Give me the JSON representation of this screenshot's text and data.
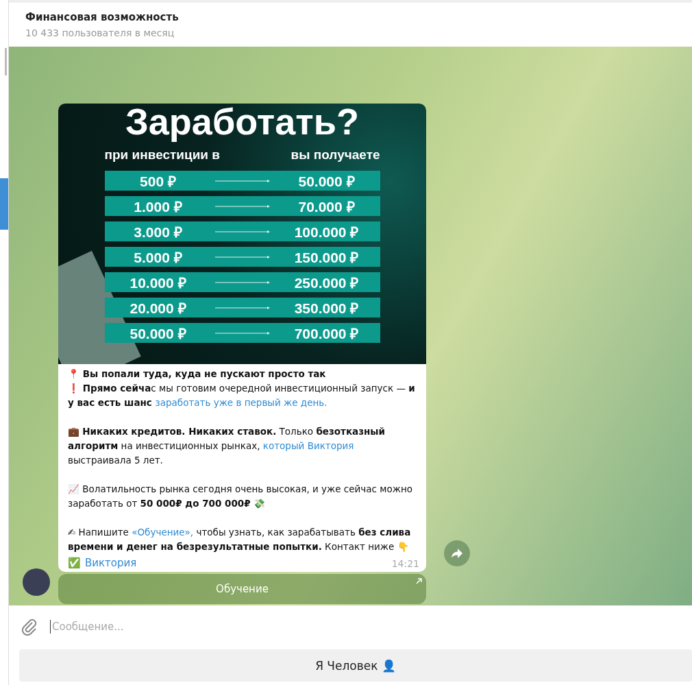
{
  "header": {
    "title": "Финансовая возможность",
    "subtitle": "10 433 пользователя в месяц"
  },
  "promo": {
    "title": "Заработать?",
    "col_left": "при инвестиции в",
    "col_right": "вы получаете",
    "rows": [
      {
        "invest": "500 ₽",
        "get": "50.000 ₽"
      },
      {
        "invest": "1.000 ₽",
        "get": "70.000 ₽"
      },
      {
        "invest": "3.000 ₽",
        "get": "100.000 ₽"
      },
      {
        "invest": "5.000 ₽",
        "get": "150.000 ₽"
      },
      {
        "invest": "10.000 ₽",
        "get": "250.000 ₽"
      },
      {
        "invest": "20.000 ₽",
        "get": "350.000 ₽"
      },
      {
        "invest": "50.000 ₽",
        "get": "700.000 ₽"
      }
    ]
  },
  "message": {
    "blocks": [
      [
        [
          {
            "kind": "bold",
            "text": "📍 Вы попали туда, куда не пускают просто так"
          }
        ],
        [
          {
            "kind": "bold",
            "text": "❗ Прямо сейча"
          },
          {
            "kind": "plain",
            "text": "с мы готовим очередной инвестиционный запуск — "
          },
          {
            "kind": "bold",
            "text": "и у вас есть шанс "
          },
          {
            "kind": "link",
            "text": "заработать уже в первый же день."
          }
        ]
      ],
      [
        [
          {
            "kind": "plain",
            "text": "💼 "
          },
          {
            "kind": "bold",
            "text": "Никаких кредитов. Никаких ставок."
          },
          {
            "kind": "plain",
            "text": " Только "
          },
          {
            "kind": "bold",
            "text": "безотказный алгоритм"
          },
          {
            "kind": "plain",
            "text": " на инвестиционных рынках, "
          },
          {
            "kind": "link",
            "text": "который Виктория"
          },
          {
            "kind": "plain",
            "text": " выстраивала 5 лет."
          }
        ]
      ],
      [
        [
          {
            "kind": "plain",
            "text": "📈 Волатильность рынка сегодня очень высокая, и уже сейчас можно заработать от "
          },
          {
            "kind": "bold",
            "text": "50  000₽ до 700 000₽"
          },
          {
            "kind": "plain",
            "text": " 💸"
          }
        ]
      ],
      [
        [
          {
            "kind": "plain",
            "text": "✍ Напишите "
          },
          {
            "kind": "link",
            "text": "«Обучение»,"
          },
          {
            "kind": "plain",
            "text": " чтобы узнать, как зарабатывать "
          },
          {
            "kind": "bold",
            "text": "без слива времени и денег на безрезультатные попытки."
          },
          {
            "kind": "plain",
            "text": " Контакт ниже 👇"
          }
        ]
      ]
    ],
    "signature_mark": "✅",
    "signature": "Виктория",
    "time": "14:21",
    "button": "Обучение"
  },
  "composer": {
    "placeholder": "Сообщение..."
  },
  "bottom_button": "Я Человек 👤"
}
